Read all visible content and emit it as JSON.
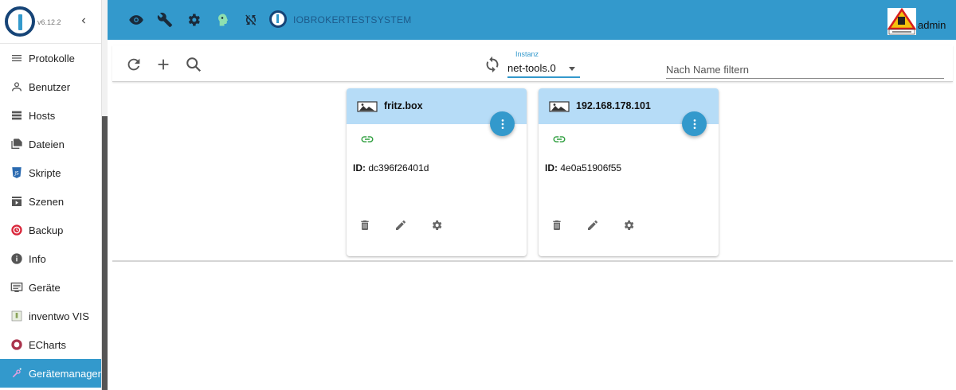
{
  "app": {
    "version": "v6.12.2",
    "system_name": "IOBROKERTESTSYSTEM",
    "username": "admin"
  },
  "sidebar": {
    "collapse_icon": "chevron-left-icon",
    "items": [
      {
        "label": "Protokolle",
        "icon": "list-icon"
      },
      {
        "label": "Benutzer",
        "icon": "person-icon"
      },
      {
        "label": "Hosts",
        "icon": "server-icon"
      },
      {
        "label": "Dateien",
        "icon": "files-icon"
      },
      {
        "label": "Skripte",
        "icon": "javascript-icon"
      },
      {
        "label": "Szenen",
        "icon": "scenes-icon"
      },
      {
        "label": "Backup",
        "icon": "backup-icon"
      },
      {
        "label": "Info",
        "icon": "info-icon"
      },
      {
        "label": "Geräte",
        "icon": "devices-icon"
      },
      {
        "label": "inventwo VIS",
        "icon": "inventwo-icon"
      },
      {
        "label": "ECharts",
        "icon": "echarts-icon"
      },
      {
        "label": "Gerätemanager",
        "icon": "device-manager-icon",
        "active": true
      }
    ]
  },
  "topbar": {
    "icons": [
      "eye-icon",
      "wrench-icon",
      "gear-icon",
      "head-icon",
      "sync-disabled-icon"
    ]
  },
  "toolbar": {
    "instance_label": "Instanz",
    "instance_value": "net-tools.0",
    "filter_placeholder": "Nach Name filtern"
  },
  "devices": [
    {
      "name": "fritz.box",
      "id_label": "ID:",
      "id_value": "dc396f26401d"
    },
    {
      "name": "192.168.178.101",
      "id_label": "ID:",
      "id_value": "4e0a51906f55"
    }
  ],
  "colors": {
    "primary": "#3399cc",
    "card_header": "#b6dcf7",
    "link_icon": "#2e9e3e",
    "logo_dark": "#164477"
  }
}
